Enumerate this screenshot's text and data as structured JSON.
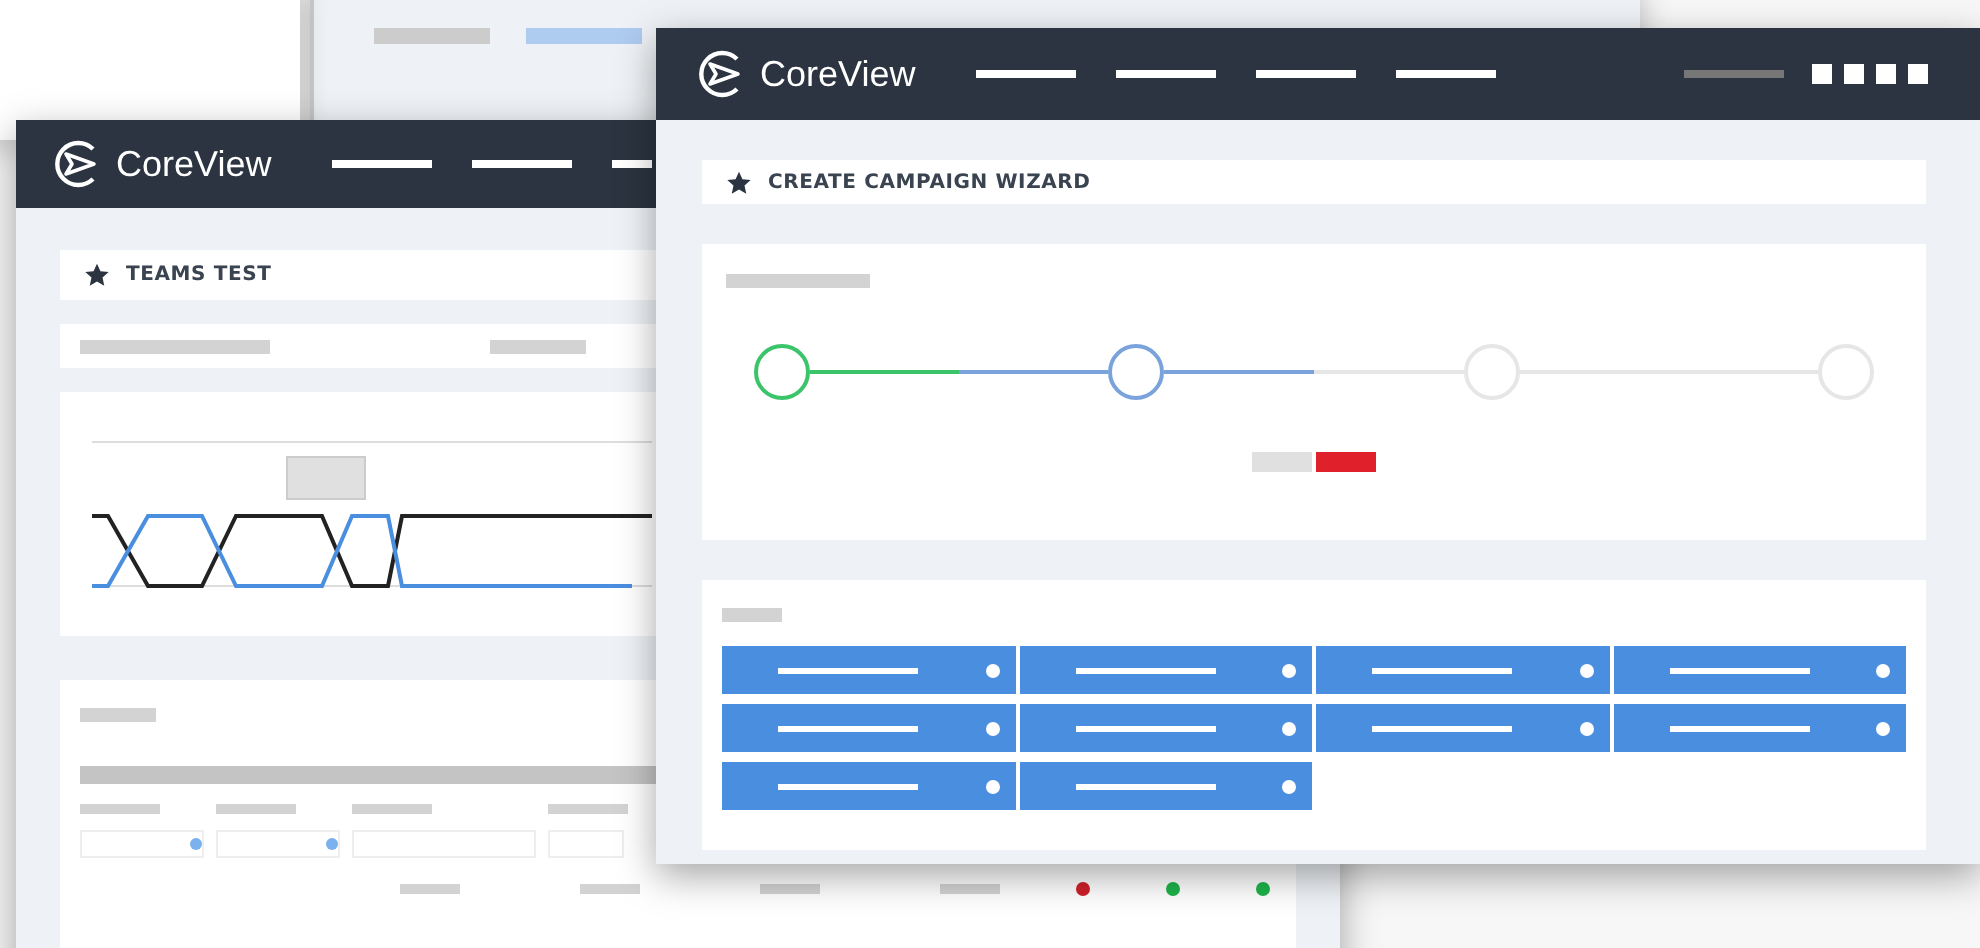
{
  "left_window": {
    "logo": "CoreView",
    "title": "TEAMS TEST",
    "status_dots": [
      {
        "color": "#d0202a"
      },
      {
        "color": "#1fb44a"
      },
      {
        "color": "#1fb44a"
      }
    ]
  },
  "front_window": {
    "logo": "CoreView",
    "title": "CREATE CAMPAIGN WIZARD",
    "steps": [
      {
        "kind": "done"
      },
      {
        "kind": "current"
      },
      {
        "kind": "pending"
      },
      {
        "kind": "pending"
      }
    ]
  }
}
